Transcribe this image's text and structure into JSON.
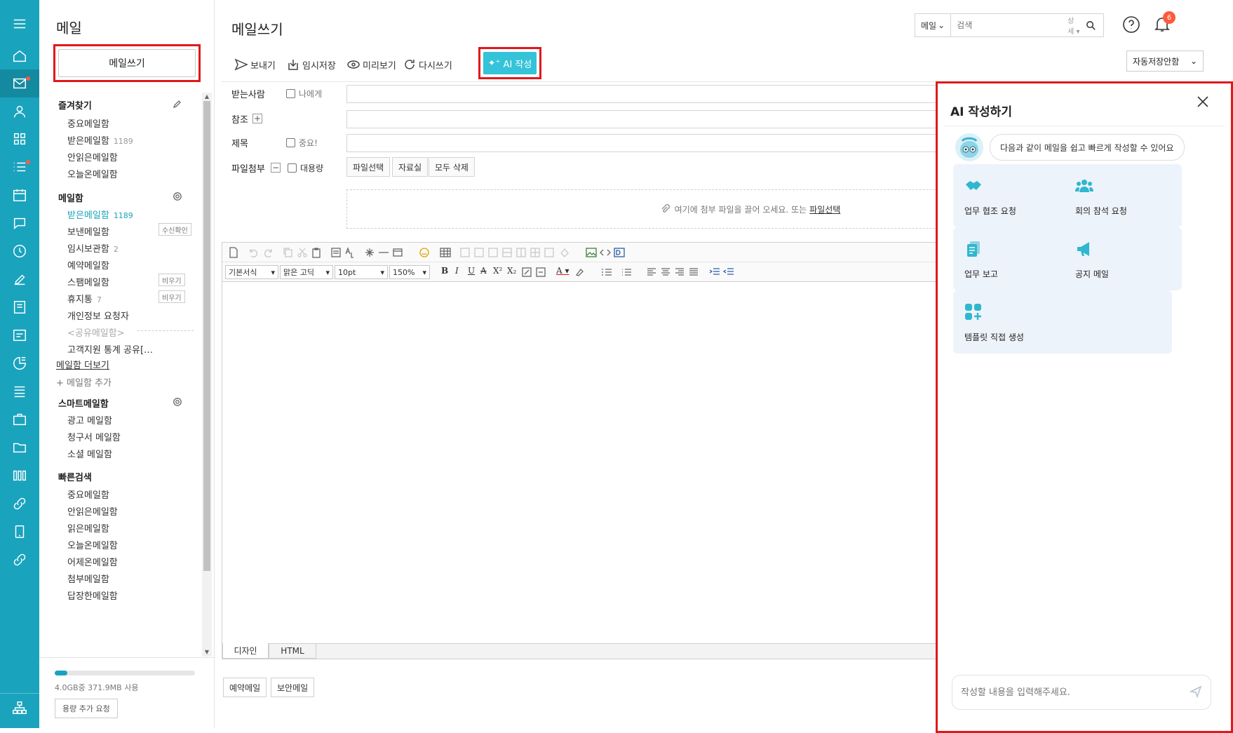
{
  "left_panel": {
    "title": "메일",
    "compose_label": "메일쓰기",
    "favorites": {
      "title": "즐겨찾기",
      "items": [
        {
          "label": "중요메일함",
          "count": ""
        },
        {
          "label": "받은메일함",
          "count": "1189"
        },
        {
          "label": "안읽은메일함",
          "count": ""
        },
        {
          "label": "오늘온메일함",
          "count": ""
        }
      ]
    },
    "mailboxes": {
      "title": "메일함",
      "items": [
        {
          "label": "받은메일함",
          "count": "1189",
          "action": ""
        },
        {
          "label": "보낸메일함",
          "count": "",
          "action": "수신확인"
        },
        {
          "label": "임시보관함",
          "count": "2",
          "action": ""
        },
        {
          "label": "예약메일함",
          "count": "",
          "action": ""
        },
        {
          "label": "스팸메일함",
          "count": "",
          "action": "비우기"
        },
        {
          "label": "휴지통",
          "count": "7",
          "action": "비우기"
        },
        {
          "label": "개인정보 요청자",
          "count": "",
          "action": ""
        }
      ],
      "shared_label": "<공유메일함>",
      "shared_item": "고객지원 통계 공유[…",
      "more_link": "메일함 더보기",
      "add_label": "메일함 추가"
    },
    "smart": {
      "title": "스마트메일함",
      "items": [
        "광고 메일함",
        "청구서 메일함",
        "소셜 메일함"
      ]
    },
    "quick": {
      "title": "빠른검색",
      "items": [
        "중요메일함",
        "안읽은메일함",
        "읽은메일함",
        "오늘온메일함",
        "어제온메일함",
        "첨부메일함",
        "답장한메일함"
      ]
    },
    "storage": {
      "text": "4.0GB중 371.9MB 사용",
      "used_fraction": 0.09,
      "button": "용량 추가 요청"
    }
  },
  "main": {
    "title": "메일쓰기",
    "search": {
      "scope": "메일",
      "placeholder": "검색",
      "detail": "상세"
    },
    "notifications_count": "6",
    "toolbar": {
      "send": "보내기",
      "draft": "임시저장",
      "preview": "미리보기",
      "rewrite": "다시쓰기",
      "ai": "AI 작성"
    },
    "autosave": "자동저장안함",
    "fields": {
      "to": "받는사람",
      "to_self": "나에게",
      "cc": "참조",
      "subject": "제목",
      "important": "중요!",
      "attach": "파일첨부",
      "large": "대용량",
      "file_select": "파일선택",
      "library": "자료실",
      "delete_all": "모두 삭제",
      "dropzone_text": "여기에 첨부 파일을 끌어 오세요. 또는",
      "dropzone_link": "파일선택"
    },
    "editor": {
      "style": "기본서식",
      "font": "맑은 고딕",
      "size": "10pt",
      "line_height": "150%",
      "tab_design": "디자인",
      "tab_html": "HTML"
    },
    "bottom": {
      "reserve": "예약메일",
      "secure": "보안메일"
    }
  },
  "ai_panel": {
    "title": "AI 작성하기",
    "intro": "다음과 같이 메일을 쉽고 빠르게 작성할 수 있어요",
    "cards": [
      {
        "label": "업무 협조 요청",
        "icon": "handshake-icon"
      },
      {
        "label": "회의 참석 요청",
        "icon": "people-icon"
      },
      {
        "label": "업무 보고",
        "icon": "document-icon"
      },
      {
        "label": "공지 메일",
        "icon": "megaphone-icon"
      },
      {
        "label": "템플릿 직접 생성",
        "icon": "grid-plus-icon"
      }
    ],
    "input_placeholder": "작성할 내용을 입력해주세요.",
    "accent": "#34c3d8"
  },
  "colors": {
    "rail": "#1aa3bd",
    "highlight": "#e0181c",
    "ai_button": "#34c3d8",
    "card_bg": "#edf3fa"
  }
}
